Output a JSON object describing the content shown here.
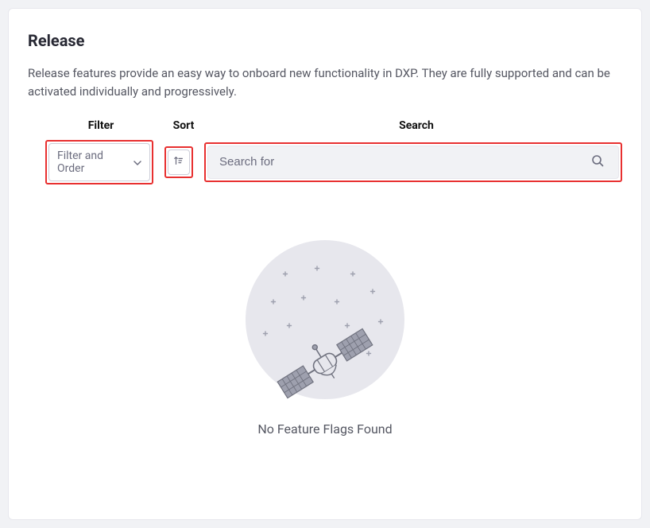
{
  "header": {
    "title": "Release",
    "description": "Release features provide an easy way to onboard new functionality in DXP. They are fully supported and can be activated individually and progressively."
  },
  "toolbar": {
    "filter_label": "Filter",
    "sort_label": "Sort",
    "search_label": "Search",
    "filter_button": "Filter and Order",
    "search_placeholder": "Search for"
  },
  "empty_state": {
    "message": "No Feature Flags Found"
  },
  "colors": {
    "highlight": "#e83030",
    "muted": "#6b6c7e",
    "illustration_bg": "#e7e7ed",
    "illustration_stroke": "#828599"
  }
}
